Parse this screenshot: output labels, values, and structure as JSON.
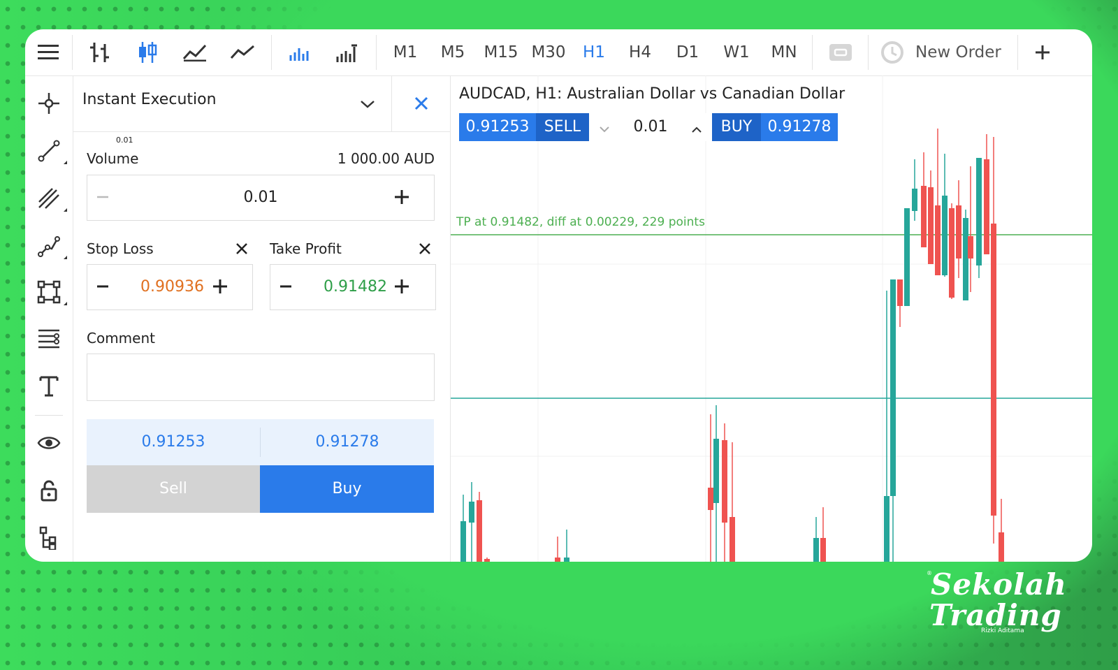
{
  "toolbar": {
    "timeframes": [
      "M1",
      "M5",
      "M15",
      "M30",
      "H1",
      "H4",
      "D1",
      "W1",
      "MN"
    ],
    "active_timeframe": "H1",
    "new_order_label": "New Order"
  },
  "order_panel": {
    "execution_mode": "Instant Execution",
    "volume_hint": "0.01",
    "volume_label": "Volume",
    "volume_amount": "1 000.00 AUD",
    "volume_value": "0.01",
    "stop_loss_label": "Stop Loss",
    "stop_loss_value": "0.90936",
    "take_profit_label": "Take Profit",
    "take_profit_value": "0.91482",
    "comment_label": "Comment",
    "comment_value": "",
    "bid": "0.91253",
    "ask": "0.91278",
    "sell_label": "Sell",
    "buy_label": "Buy"
  },
  "chart": {
    "title": "AUDCAD, H1: Australian Dollar vs Canadian Dollar",
    "trade_sell_price": "0.91253",
    "trade_sell_label": "SELL",
    "trade_volume": "0.01",
    "trade_buy_label": "BUY",
    "trade_buy_price": "0.91278",
    "tp_line_label": "TP at 0.91482, diff at 0.00229, 229 points"
  },
  "colors": {
    "accent": "#2a7bea",
    "bull": "#26a69a",
    "bear": "#ef5350",
    "stop_loss": "#e07020",
    "take_profit": "#2e9e48"
  },
  "logo": {
    "line1": "Sekolah",
    "line2": "Trading",
    "byline": "Rizki Aditama"
  }
}
